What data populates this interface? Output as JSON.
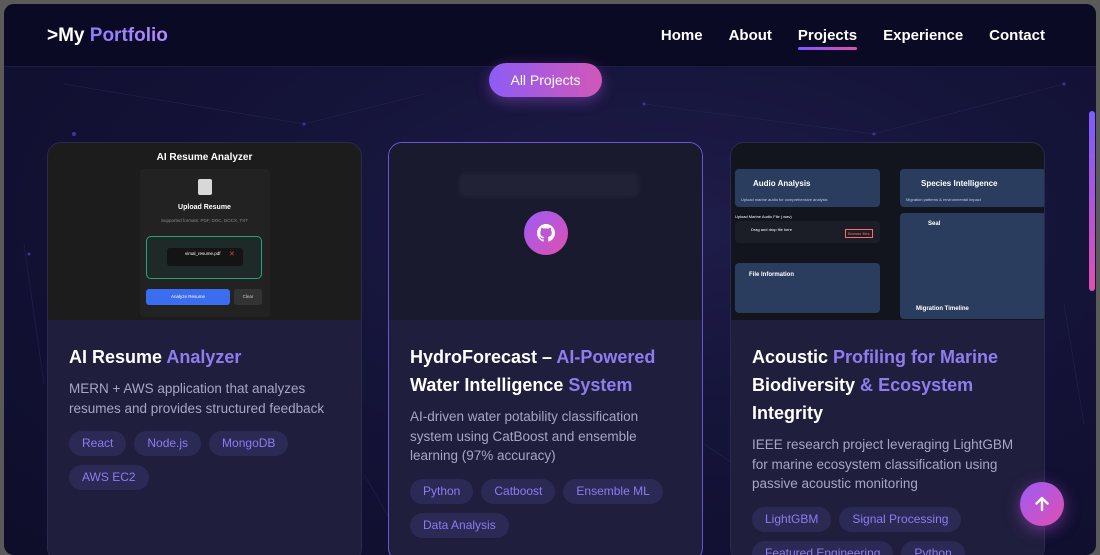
{
  "nav": {
    "logo_prefix": ">My ",
    "logo_accent": "Portfolio",
    "items": [
      {
        "label": "Home",
        "active": false
      },
      {
        "label": "About",
        "active": false
      },
      {
        "label": "Projects",
        "active": true
      },
      {
        "label": "Experience",
        "active": false
      },
      {
        "label": "Contact",
        "active": false
      }
    ]
  },
  "filter": {
    "label": "All Projects"
  },
  "projects": [
    {
      "title_white": "AI Resume ",
      "title_accent": "Analyzer",
      "description": "MERN + AWS application that analyzes resumes and provides structured feedback",
      "tags": [
        "React",
        "Node.js",
        "MongoDB",
        "AWS EC2"
      ],
      "thumb": {
        "title": "AI Resume Analyzer",
        "upload_label": "Upload Resume",
        "supported": "Supported formats: PDF, DOC, DOCX, TXT",
        "file_name": "vimal_resume.pdf",
        "analyze_label": "Analyze Resume",
        "clear_label": "Clear"
      }
    },
    {
      "title_parts": [
        {
          "text": "HydroForecast – ",
          "accent": false
        },
        {
          "text": "AI-Powered",
          "accent": true
        },
        {
          "text": " Water Intelligence ",
          "accent": false
        },
        {
          "text": "System",
          "accent": true
        }
      ],
      "description": "AI-driven water potability classification system using CatBoost and ensemble learning (97% accuracy)",
      "tags": [
        "Python",
        "Catboost",
        "Ensemble ML",
        "Data Analysis"
      ]
    },
    {
      "title_parts": [
        {
          "text": "Acoustic ",
          "accent": false
        },
        {
          "text": "Profiling for Marine",
          "accent": true
        },
        {
          "text": " Biodiversity ",
          "accent": false
        },
        {
          "text": "&",
          "accent": true
        },
        {
          "text": " ",
          "accent": false
        },
        {
          "text": "Ecosystem",
          "accent": true
        },
        {
          "text": " Integrity",
          "accent": false
        }
      ],
      "description": "IEEE research project leveraging LightGBM for marine ecosystem classification using passive acoustic monitoring",
      "tags": [
        "LightGBM",
        "Signal Processing",
        "Featured Engineering",
        "Python"
      ],
      "thumb": {
        "audio_title": "Audio Analysis",
        "audio_sub": "Upload marine audio for comprehensive analysis",
        "species_title": "Species Intelligence",
        "species_sub": "Migration patterns & environmental impact",
        "upload_title": "Upload Marine Audio File (.wav)",
        "drop_text": "Drag and drop file here",
        "browse_label": "Browse files",
        "seal_label": "Seal",
        "file_info": "File Information",
        "migration": "Migration Timeline"
      }
    }
  ]
}
